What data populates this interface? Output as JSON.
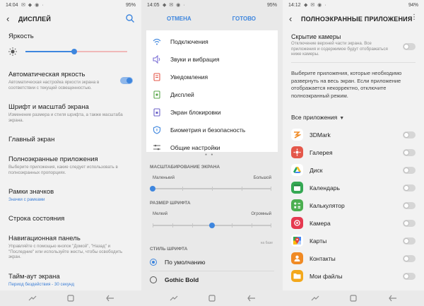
{
  "panel1": {
    "status": {
      "time": "14:04",
      "indicators": "✉ ◆ ◉ ·",
      "right": "95%"
    },
    "title": "ДИСПЛЕЙ",
    "brightness_label": "Яркость",
    "brightness_value": 0.48,
    "items": [
      {
        "title": "Автоматическая яркость",
        "sub": "Автоматическая настройка яркости экрана в соответствии с текущей освещенностью."
      },
      {
        "title": "Шрифт и масштаб экрана",
        "sub": "Изменение размера и стиля шрифта, а также масштаба экрана."
      },
      {
        "title": "Главный экран",
        "sub": ""
      },
      {
        "title": "Полноэкранные приложения",
        "sub": "Выберите приложения, какие следует использовать в полноэкранных пропорциях."
      },
      {
        "title": "Рамки значков",
        "sub": "Значки с рамками"
      },
      {
        "title": "Строка состояния",
        "sub": ""
      },
      {
        "title": "Навигационная панель",
        "sub": "Управляйте с помощью кнопок \"Домой\", \"Назад\" и \"Последние\" или используйте жесты, чтобы освободить экран."
      },
      {
        "title": "Тайм-аут экрана",
        "sub": "Период бездействия - 30 секунд"
      }
    ],
    "auto_brightness_on": true
  },
  "panel2": {
    "status": {
      "time": "14:05",
      "indicators": "◆ ✉ ◉ ·",
      "right": "95%"
    },
    "cancel": "ОТМЕНА",
    "done": "ГОТОВО",
    "menu": [
      {
        "label": "Подключения",
        "icon": "wifi-icon"
      },
      {
        "label": "Звуки и вибрация",
        "icon": "sound-icon"
      },
      {
        "label": "Уведомления",
        "icon": "notifications-icon"
      },
      {
        "label": "Дисплей",
        "icon": "display-icon"
      },
      {
        "label": "Экран блокировки",
        "icon": "lock-screen-icon"
      },
      {
        "label": "Биометрия и безопасность",
        "icon": "shield-icon"
      },
      {
        "label": "Общие настройки",
        "icon": "sliders-icon"
      }
    ],
    "zoom_title": "МАСШТАБИРОВАНИЕ ЭКРАНА",
    "zoom_small": "Маленький",
    "zoom_large": "Большой",
    "zoom_level": 0,
    "font_title": "РАЗМЕР ШРИФТА",
    "font_small": "Мелкий",
    "font_large": "Огромный",
    "font_level": 0.5,
    "font_extra": "на базе",
    "style_title": "СТИЛЬ ШРИФТА",
    "styles": [
      "По умолчанию",
      "Gothic Bold"
    ]
  },
  "panel3": {
    "status": {
      "time": "14:12",
      "indicators": "◆ ✉ ◉ ·",
      "right": "94%"
    },
    "title": "ПОЛНОЭКРАННЫЕ ПРИЛОЖЕНИЯ",
    "camera_title": "Скрытие камеры",
    "camera_desc": "Отключение верхней части экрана. Все приложения и содержимое будут отображаться ниже камеры.",
    "desc": "Выберите приложения, которые необходимо развернуть на весь экран. Если приложение отображается некорректно, отключите полноэкранный режим.",
    "filter": "Все приложения",
    "apps": [
      {
        "label": "3DMark",
        "color": "#ffffff",
        "icon": "3dmark-icon"
      },
      {
        "label": "Галерея",
        "color": "#e4574a",
        "icon": "gallery-icon"
      },
      {
        "label": "Диск",
        "color": "#ffffff",
        "icon": "drive-icon"
      },
      {
        "label": "Календарь",
        "color": "#35a853",
        "icon": "calendar-icon"
      },
      {
        "label": "Калькулятор",
        "color": "#4caf50",
        "icon": "calculator-icon"
      },
      {
        "label": "Камера",
        "color": "#e53950",
        "icon": "camera-icon"
      },
      {
        "label": "Карты",
        "color": "#ffffff",
        "icon": "maps-icon"
      },
      {
        "label": "Контакты",
        "color": "#f08a24",
        "icon": "contacts-icon"
      },
      {
        "label": "Мои файлы",
        "color": "#f3a81c",
        "icon": "folder-icon"
      }
    ]
  }
}
